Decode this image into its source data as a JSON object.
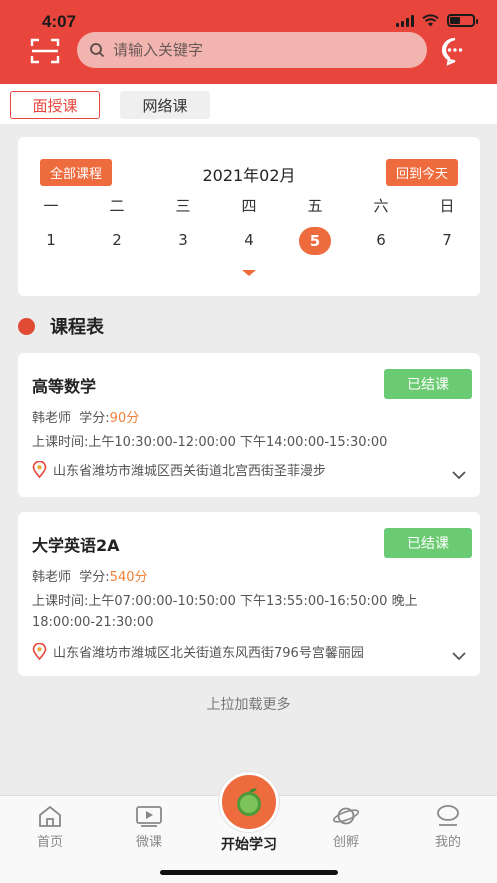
{
  "status_bar": {
    "time": "4:07"
  },
  "header": {
    "search_placeholder": "请输入关键字"
  },
  "tabs": [
    {
      "label": "面授课",
      "active": true
    },
    {
      "label": "网络课",
      "active": false
    }
  ],
  "calendar": {
    "all_courses_label": "全部课程",
    "month": "2021年02月",
    "today_label": "回到今天",
    "weekdays": [
      "一",
      "二",
      "三",
      "四",
      "五",
      "六",
      "日"
    ],
    "dates": [
      "1",
      "2",
      "3",
      "4",
      "5",
      "6",
      "7"
    ],
    "selected_index": 4
  },
  "section": {
    "title": "课程表"
  },
  "courses": [
    {
      "title": "高等数学",
      "status": "已结课",
      "teacher": "韩老师",
      "credit_label": "学分:",
      "credit_value": "90分",
      "time": "上课时间:上午10:30:00-12:00:00 下午14:00:00-15:30:00",
      "location": "山东省潍坊市潍城区西关街道北宫西街圣菲漫步"
    },
    {
      "title": "大学英语2A",
      "status": "已结课",
      "teacher": "韩老师",
      "credit_label": "学分:",
      "credit_value": "540分",
      "time": "上课时间:上午07:00:00-10:50:00 下午13:55:00-16:50:00 晚上18:00:00-21:30:00",
      "location": "山东省潍坊市潍城区北关街道东风西街796号宫馨丽园"
    }
  ],
  "load_more": "上拉加载更多",
  "bottom_nav": {
    "home": "首页",
    "micro": "微课",
    "start": "开始学习",
    "incubate": "创孵",
    "mine": "我的"
  },
  "colors": {
    "brand": "#e8453c",
    "accent": "#ee6b3d",
    "status_green": "#6bcb73"
  }
}
